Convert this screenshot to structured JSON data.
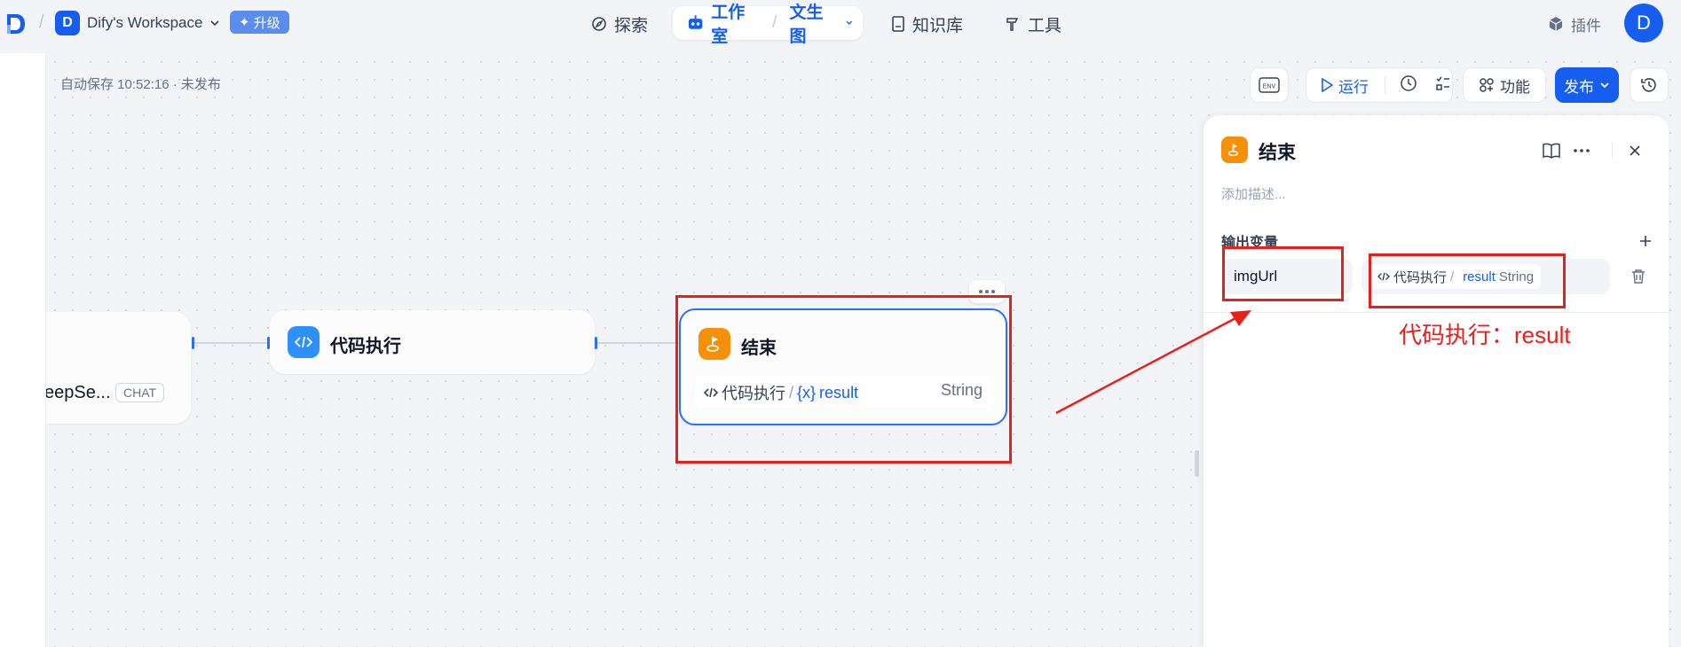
{
  "header": {
    "workspace_initial": "D",
    "workspace_name": "Dify's Workspace",
    "upgrade_label": "升级",
    "nav": {
      "explore": "探索",
      "studio": "工作室",
      "app": "文生图",
      "knowledge": "知识库",
      "tools": "工具",
      "plugins": "插件"
    },
    "user_initial": "D"
  },
  "canvas": {
    "autosave": "自动保存 10:52:16 · 未发布",
    "toolbar": {
      "env": "ENV",
      "run": "运行",
      "features": "功能",
      "publish": "发布"
    },
    "nodes": {
      "llm_partial_text": "eepSe...",
      "llm_badge": "CHAT",
      "code_title": "代码执行",
      "end_title": "结束",
      "end_var_source": "代码执行",
      "end_var_sep": "/",
      "end_var_prefix": "{x}",
      "end_var_name": "result",
      "end_var_type": "String"
    }
  },
  "panel": {
    "title": "结束",
    "desc_placeholder": "添加描述...",
    "section_title": "输出变量",
    "var_name": "imgUrl",
    "ref_source": "代码执行",
    "ref_sep": "/",
    "ref_var": "result",
    "ref_type": "String"
  },
  "annotation": {
    "label": "代码执行：result",
    "color": "#e8201c"
  },
  "colors": {
    "primary": "#155eef",
    "end_node": "#f79009",
    "code_node": "#2e90fa"
  }
}
